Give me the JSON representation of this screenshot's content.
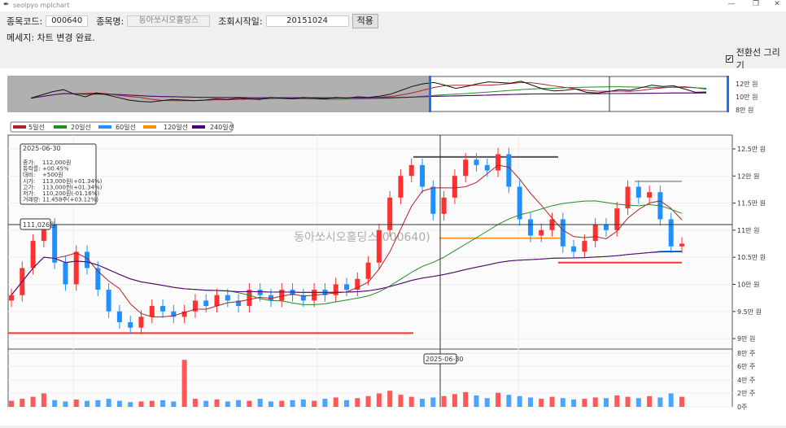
{
  "window": {
    "title": "seolpyo mplchart",
    "controls": [
      "—",
      "❐",
      "✕"
    ]
  },
  "form": {
    "code_label": "종목코드:",
    "code_value": "000640",
    "name_label": "종목명:",
    "name_value": "동아쏘시오홀딩스",
    "start_label": "조회시작일:",
    "start_value": "20151024",
    "apply_label": "적용"
  },
  "message": "메세지: 차트 변경 완료.",
  "checkbox": {
    "label": "전환선 그리기",
    "checked": true
  },
  "legend": [
    {
      "label": "5일선",
      "color": "#b22222",
      "window": 5
    },
    {
      "label": "20일선",
      "color": "#228b22",
      "window": 20
    },
    {
      "label": "60일선",
      "color": "#1e90ff",
      "window": 60
    },
    {
      "label": "120일선",
      "color": "#ff8c00",
      "window": 120
    },
    {
      "label": "240일선",
      "color": "#4b0082",
      "window": 240
    }
  ],
  "colors": {
    "up": "#ff3030",
    "down": "#1e90ff",
    "crosshair": "#333333",
    "overview_shade": "#b0b0b0",
    "slider": "#1e70ff"
  },
  "watermark": "동아쏘시오홀딩스(000640)",
  "tooltip": {
    "date": "2025-06-30",
    "rows": [
      [
        "종가:",
        "112,000원"
      ],
      [
        "등락률:",
        "+00.45%"
      ],
      [
        "대비:",
        "+500원"
      ],
      [
        "시가:",
        "113,000원(+01.34%)"
      ],
      [
        "고가:",
        "113,000원(+01.34%)"
      ],
      [
        "저가:",
        "110,200원(-01.16%)"
      ],
      [
        "거래량:",
        "11,458주(+03.12%)"
      ]
    ]
  },
  "crosshair": {
    "price_label": "111,026원",
    "date_label": "2025-06-30",
    "price": 111026
  },
  "overview_axis": [
    "12만 원",
    "10만 원",
    "8만 원"
  ],
  "price_axis": [
    "12.5만 원",
    "12만 원",
    "11.5만 원",
    "11만 원",
    "10.5만 원",
    "10만 원",
    "9.5만 원",
    "9만 원"
  ],
  "volume_axis": [
    "8만 주",
    "6만 주",
    "4만 주",
    "2만 주",
    "0주"
  ],
  "chart_data": {
    "type": "candlestick",
    "price_unit": "원",
    "volume_unit": "주",
    "ylim": [
      88500,
      127000
    ],
    "volume_ylim": [
      0,
      80000
    ],
    "close": [
      98000,
      103000,
      108000,
      111000,
      104000,
      100000,
      106000,
      103000,
      99000,
      95000,
      93000,
      92000,
      94000,
      96000,
      95000,
      94000,
      95000,
      97000,
      96000,
      98000,
      97000,
      96000,
      99000,
      98000,
      97000,
      99000,
      98000,
      97000,
      99000,
      98000,
      100000,
      99000,
      101000,
      104000,
      110000,
      116000,
      120000,
      122000,
      118000,
      113000,
      116000,
      120000,
      123000,
      122000,
      121000,
      124000,
      118000,
      112000,
      109000,
      110000,
      112000,
      107000,
      106000,
      108000,
      111000,
      110000,
      114000,
      118000,
      116000,
      117000,
      112000,
      107000,
      107500
    ],
    "volume": [
      9000,
      12000,
      15000,
      20000,
      10000,
      8000,
      11000,
      9000,
      10000,
      12000,
      9000,
      7000,
      8000,
      9000,
      10000,
      8000,
      70000,
      12000,
      9000,
      11000,
      8000,
      10000,
      9000,
      12000,
      8000,
      9000,
      10000,
      11000,
      9000,
      12000,
      14000,
      10000,
      13000,
      16000,
      20000,
      24000,
      18000,
      15000,
      12000,
      14000,
      16000,
      19000,
      22000,
      17000,
      13000,
      21000,
      18000,
      16000,
      14000,
      12000,
      15000,
      13000,
      11000,
      12000,
      14000,
      13000,
      17000,
      15000,
      13000,
      16000,
      14000,
      20000,
      15000
    ],
    "levels": [
      {
        "price": 123500,
        "color": "#555555"
      },
      {
        "price": 119000,
        "color": "#aaaaaa"
      },
      {
        "price": 108500,
        "color": "#ffa020"
      },
      {
        "price": 104000,
        "color": "#ff3030"
      },
      {
        "price": 91000,
        "color": "#ff3030"
      }
    ]
  }
}
